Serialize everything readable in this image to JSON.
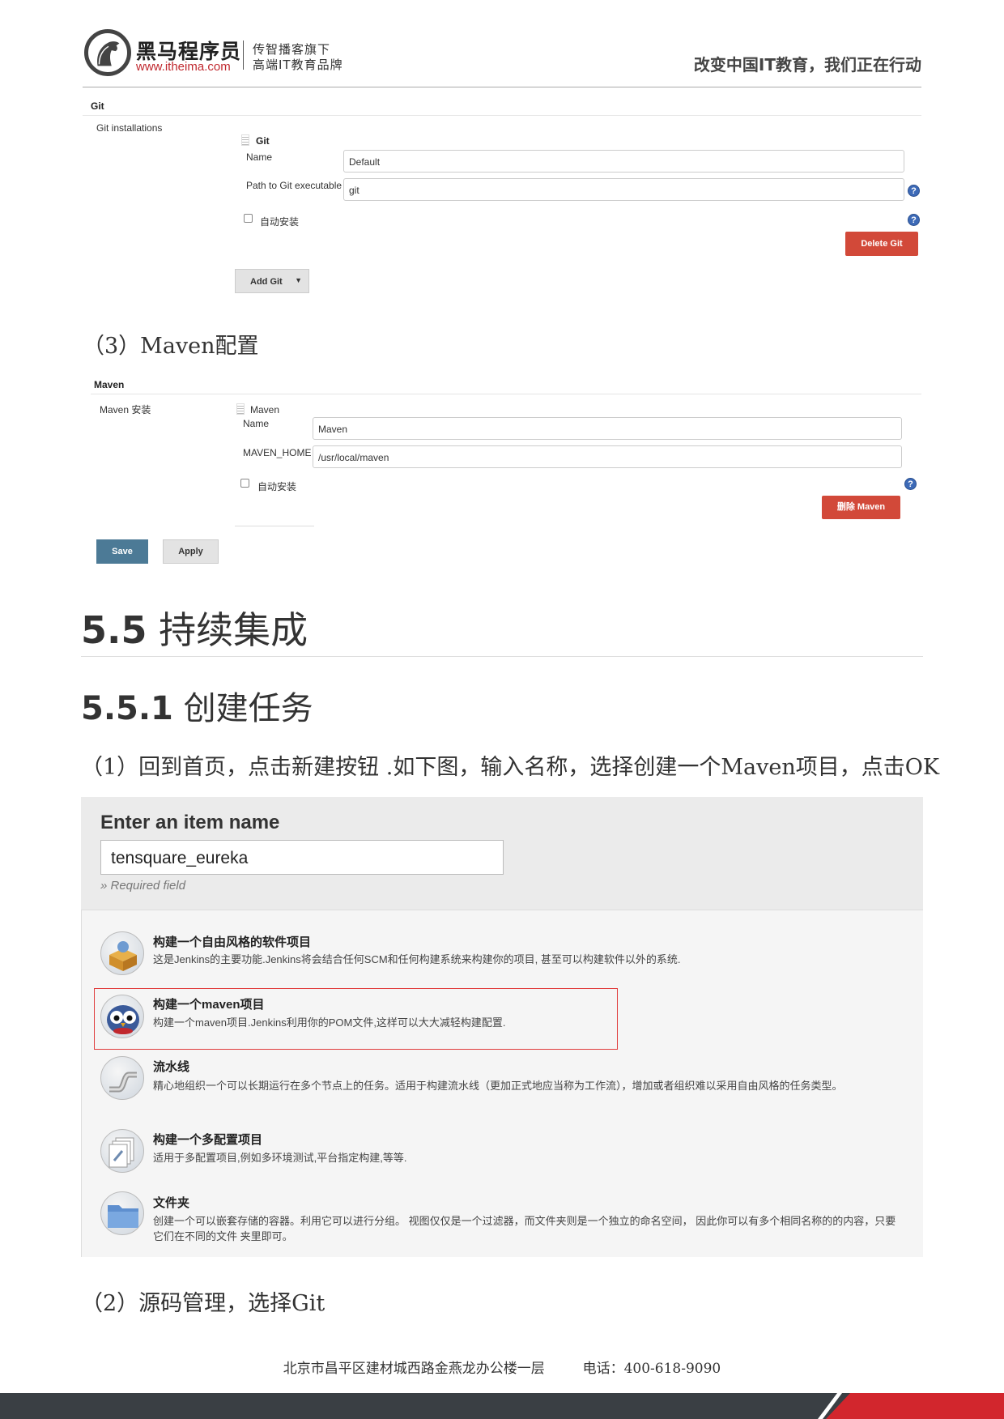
{
  "header": {
    "brand_name": "黑马程序员",
    "brand_url": "www.itheima.com",
    "slogan_line1": "传智播客旗下",
    "slogan_line2": "高端IT教育品牌",
    "tagline": "改变中国IT教育，我们正在行动"
  },
  "git_panel": {
    "section_title": "Git",
    "installations_label": "Git installations",
    "item_title": "Git",
    "name_label": "Name",
    "name_value": "Default",
    "path_label": "Path to Git executable",
    "path_value": "git",
    "auto_install_label": "自动安装",
    "delete_button": "Delete Git",
    "add_button": "Add Git"
  },
  "step3_heading": "（3）Maven配置",
  "maven_panel": {
    "section_title": "Maven",
    "installations_label": "Maven 安装",
    "item_title": "Maven",
    "name_label": "Name",
    "name_value": "Maven",
    "home_label": "MAVEN_HOME",
    "home_value": "/usr/local/maven",
    "auto_install_label": "自动安装",
    "delete_button": "删除 Maven",
    "save_button": "Save",
    "apply_button": "Apply"
  },
  "section_55": {
    "number": "5.5",
    "title": "持续集成"
  },
  "section_551": {
    "number": "5.5.1",
    "title": "创建任务"
  },
  "step1_text": "（1）回到首页，点击新建按钮 .如下图，输入名称，选择创建一个Maven项目，点击OK",
  "new_item": {
    "title": "Enter an item name",
    "input_value": "tensquare_eureka",
    "required_hint": "» Required field",
    "items": [
      {
        "icon": "freestyle-box-icon",
        "title": "构建一个自由风格的软件项目",
        "desc": "这是Jenkins的主要功能.Jenkins将会结合任何SCM和任何构建系统来构建你的项目, 甚至可以构建软件以外的系统."
      },
      {
        "icon": "maven-owl-icon",
        "title": "构建一个maven项目",
        "desc": "构建一个maven项目.Jenkins利用你的POM文件,这样可以大大减轻构建配置."
      },
      {
        "icon": "pipeline-icon",
        "title": "流水线",
        "desc": "精心地组织一个可以长期运行在多个节点上的任务。适用于构建流水线（更加正式地应当称为工作流），增加或者组织难以采用自由风格的任务类型。"
      },
      {
        "icon": "multi-config-icon",
        "title": "构建一个多配置项目",
        "desc": "适用于多配置项目,例如多环境测试,平台指定构建,等等."
      },
      {
        "icon": "folder-icon",
        "title": "文件夹",
        "desc": "创建一个可以嵌套存储的容器。利用它可以进行分组。 视图仅仅是一个过滤器，而文件夹则是一个独立的命名空间， 因此你可以有多个相同名称的的内容，只要它们在不同的文件 夹里即可。"
      }
    ]
  },
  "step2_text": "（2）源码管理，选择Git",
  "footer": {
    "address": "北京市昌平区建材城西路金燕龙办公楼一层",
    "phone": "电话：400-618-9090"
  }
}
